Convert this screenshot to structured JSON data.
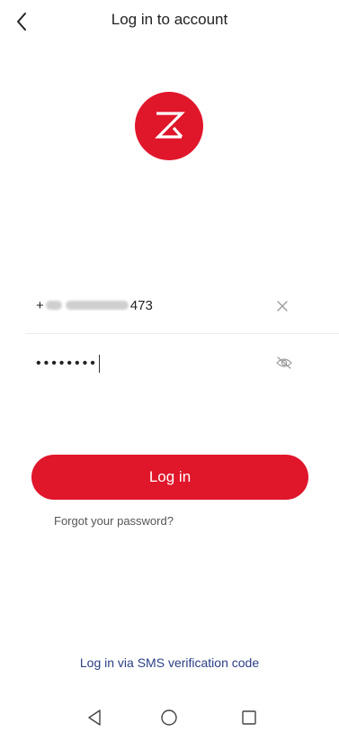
{
  "header": {
    "title": "Log in to account",
    "back_icon": "chevron-left-icon"
  },
  "logo": {
    "icon": "zeta-brand-logo",
    "bg_color": "#E0162B"
  },
  "phone_field": {
    "prefix": "+",
    "suffix": "473",
    "clear_icon": "close-icon"
  },
  "password_field": {
    "value": "••••••••",
    "visibility_icon": "eye-off-icon"
  },
  "actions": {
    "login_label": "Log in",
    "forgot_label": "Forgot your password?",
    "sms_label": "Log in via SMS verification code"
  },
  "nav": {
    "back_icon": "triangle-back-icon",
    "home_icon": "circle-home-icon",
    "recent_icon": "square-recents-icon"
  },
  "colors": {
    "accent": "#E0162B",
    "link": "#2a3f86"
  }
}
